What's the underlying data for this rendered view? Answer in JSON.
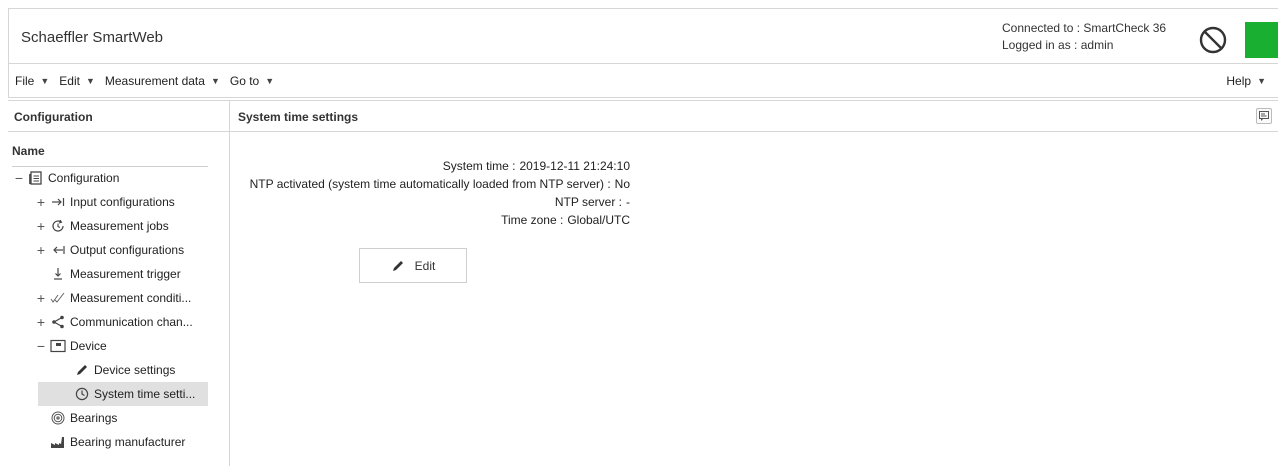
{
  "app": {
    "title": "Schaeffler SmartWeb",
    "connection_label": "Connected to :",
    "connection_value": "SmartCheck 36",
    "login_label": "Logged in as :",
    "login_value": "admin",
    "status_color": "#19b032"
  },
  "menu": {
    "items": [
      "File",
      "Edit",
      "Measurement data",
      "Go to"
    ],
    "help": "Help"
  },
  "left_panel": {
    "title": "Configuration",
    "column_header": "Name",
    "tree": [
      {
        "label": "Configuration",
        "icon": "configuration-icon",
        "expander": "−"
      },
      {
        "label": "Input configurations",
        "icon": "input-arrow-icon",
        "expander": "+"
      },
      {
        "label": "Measurement jobs",
        "icon": "measurement-jobs-icon",
        "expander": "+"
      },
      {
        "label": "Output configurations",
        "icon": "output-arrow-icon",
        "expander": "+"
      },
      {
        "label": "Measurement trigger",
        "icon": "trigger-icon",
        "expander": ""
      },
      {
        "label": "Measurement conditi...",
        "icon": "check-marks-icon",
        "expander": "+"
      },
      {
        "label": "Communication chan...",
        "icon": "share-icon",
        "expander": "+"
      },
      {
        "label": "Device",
        "icon": "device-icon",
        "expander": "−"
      },
      {
        "label": "Device settings",
        "icon": "pencil-icon",
        "expander": ""
      },
      {
        "label": "System time setti...",
        "icon": "clock-icon",
        "expander": "",
        "selected": true
      },
      {
        "label": "Bearings",
        "icon": "bearing-icon",
        "expander": ""
      },
      {
        "label": "Bearing manufacturer",
        "icon": "factory-icon",
        "expander": ""
      }
    ]
  },
  "right_panel": {
    "title": "System time settings",
    "fields": [
      {
        "key": "System time :",
        "value": "2019-12-11 21:24:10"
      },
      {
        "key": "NTP activated (system time automatically loaded from NTP server) :",
        "value": "No"
      },
      {
        "key": "NTP server :",
        "value": "-"
      },
      {
        "key": "Time zone :",
        "value": "Global/UTC"
      }
    ],
    "edit_label": "Edit"
  }
}
